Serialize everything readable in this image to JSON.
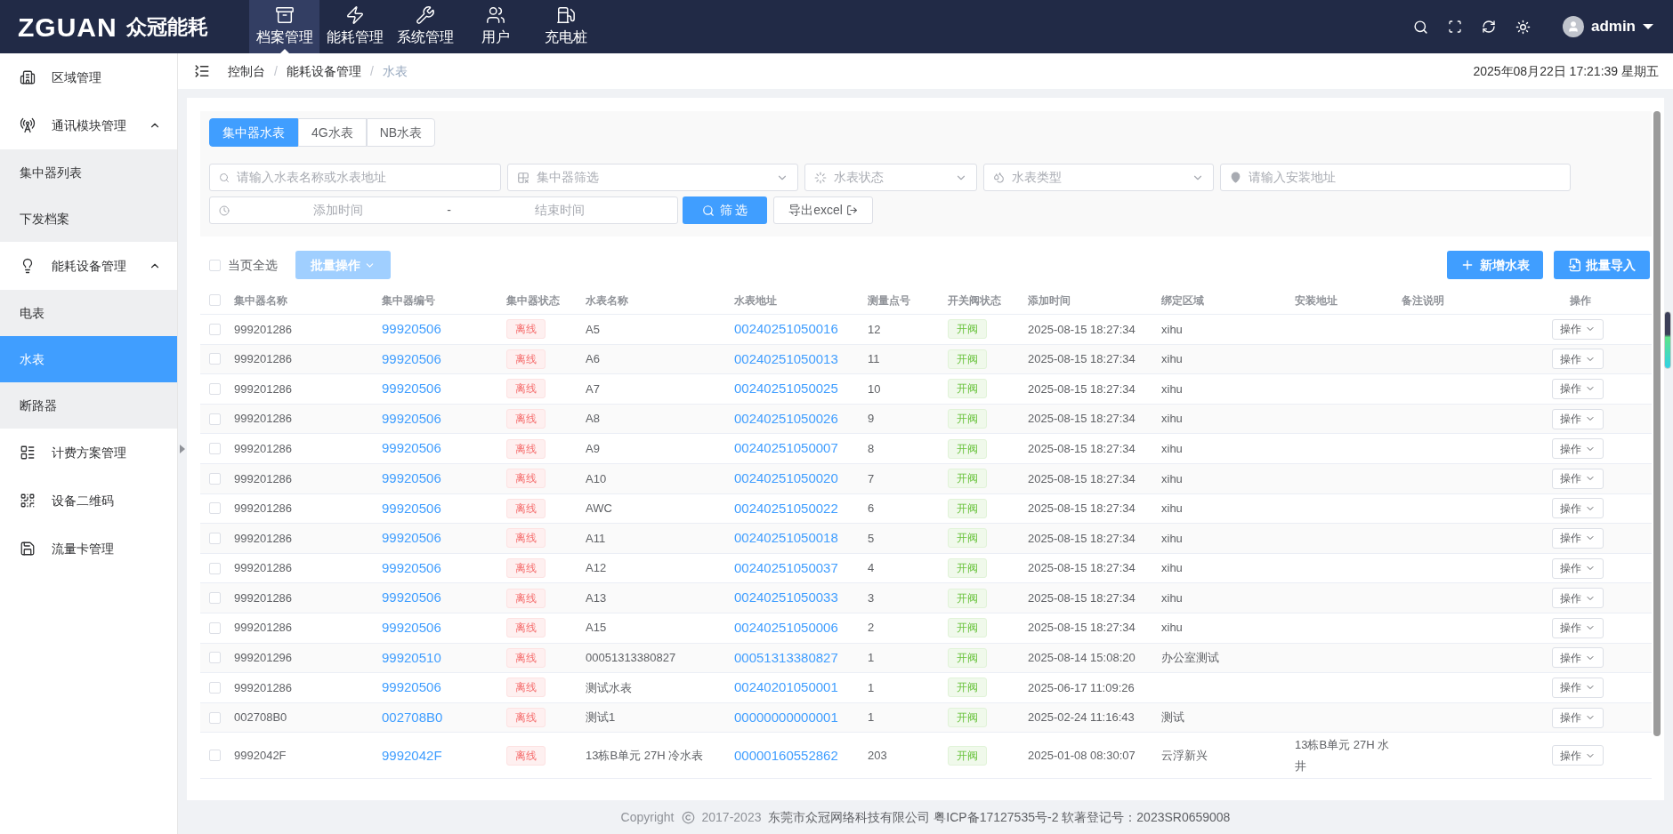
{
  "header": {
    "logo_mark": "ZGUAN",
    "logo_name": "众冠能耗",
    "nav": [
      {
        "label": "档案管理",
        "selected": true
      },
      {
        "label": "能耗管理",
        "selected": false
      },
      {
        "label": "系统管理",
        "selected": false
      },
      {
        "label": "用户",
        "selected": false
      },
      {
        "label": "充电桩",
        "selected": false
      }
    ],
    "user": "admin"
  },
  "sidebar": {
    "items": [
      {
        "label": "区域管理"
      },
      {
        "label": "通讯模块管理",
        "expanded": true,
        "children": [
          {
            "label": "集中器列表",
            "selected": false
          },
          {
            "label": "下发档案",
            "selected": false
          }
        ]
      },
      {
        "label": "能耗设备管理",
        "expanded": true,
        "children": [
          {
            "label": "电表",
            "selected": false
          },
          {
            "label": "水表",
            "selected": true
          },
          {
            "label": "断路器",
            "selected": false
          }
        ]
      },
      {
        "label": "计费方案管理"
      },
      {
        "label": "设备二维码"
      },
      {
        "label": "流量卡管理"
      }
    ]
  },
  "breadcrumb": {
    "items": [
      "控制台",
      "能耗设备管理",
      "水表"
    ],
    "separators": [
      "/",
      "/"
    ]
  },
  "datetime": "2025年08月22日 17:21:39 星期五",
  "tabs": [
    {
      "label": "集中器水表",
      "selected": true
    },
    {
      "label": "4G水表",
      "selected": false
    },
    {
      "label": "NB水表",
      "selected": false
    }
  ],
  "filters": {
    "search": {
      "placeholder": "请输入水表名称或水表地址"
    },
    "concentrator": {
      "placeholder": "集中器筛选"
    },
    "status": {
      "placeholder": "水表状态"
    },
    "type": {
      "placeholder": "水表类型"
    },
    "address": {
      "placeholder": "请输入安装地址"
    },
    "start_time": {
      "placeholder": "添加时间"
    },
    "separator": "-",
    "end_time": {
      "placeholder": "结束时间"
    },
    "filter_button": "筛 选",
    "export_button": "导出excel"
  },
  "select_all": {
    "label": "当页全选",
    "checked": false
  },
  "batch_button": "批量操作",
  "add_button": "新增水表",
  "import_button": "批量导入",
  "table": {
    "header_checked": false,
    "columns": [
      "集中器名称",
      "集中器编号",
      "集中器状态",
      "水表名称",
      "水表地址",
      "测量点号",
      "开关阀状态",
      "添加时间",
      "绑定区域",
      "安装地址",
      "备注说明",
      "操作"
    ],
    "rows": [
      {
        "checked": false,
        "name": "999201286",
        "number": "99920506",
        "status": "离线",
        "meter": "A5",
        "address": "00240251050016",
        "point": "12",
        "valve": "开阀",
        "time": "2025-08-15 18:27:34",
        "area": "xihu",
        "op": "操作"
      },
      {
        "checked": false,
        "name": "999201286",
        "number": "99920506",
        "status": "离线",
        "meter": "A6",
        "address": "00240251050013",
        "point": "11",
        "valve": "开阀",
        "time": "2025-08-15 18:27:34",
        "area": "xihu",
        "op": "操作"
      },
      {
        "checked": false,
        "name": "999201286",
        "number": "99920506",
        "status": "离线",
        "meter": "A7",
        "address": "00240251050025",
        "point": "10",
        "valve": "开阀",
        "time": "2025-08-15 18:27:34",
        "area": "xihu",
        "op": "操作"
      },
      {
        "checked": false,
        "name": "999201286",
        "number": "99920506",
        "status": "离线",
        "meter": "A8",
        "address": "00240251050026",
        "point": "9",
        "valve": "开阀",
        "time": "2025-08-15 18:27:34",
        "area": "xihu",
        "op": "操作"
      },
      {
        "checked": false,
        "name": "999201286",
        "number": "99920506",
        "status": "离线",
        "meter": "A9",
        "address": "00240251050007",
        "point": "8",
        "valve": "开阀",
        "time": "2025-08-15 18:27:34",
        "area": "xihu",
        "op": "操作"
      },
      {
        "checked": false,
        "name": "999201286",
        "number": "99920506",
        "status": "离线",
        "meter": "A10",
        "address": "00240251050020",
        "point": "7",
        "valve": "开阀",
        "time": "2025-08-15 18:27:34",
        "area": "xihu",
        "op": "操作"
      },
      {
        "checked": false,
        "name": "999201286",
        "number": "99920506",
        "status": "离线",
        "meter": "AWC",
        "address": "00240251050022",
        "point": "6",
        "valve": "开阀",
        "time": "2025-08-15 18:27:34",
        "area": "xihu",
        "op": "操作"
      },
      {
        "checked": false,
        "name": "999201286",
        "number": "99920506",
        "status": "离线",
        "meter": "A11",
        "address": "00240251050018",
        "point": "5",
        "valve": "开阀",
        "time": "2025-08-15 18:27:34",
        "area": "xihu",
        "op": "操作"
      },
      {
        "checked": false,
        "name": "999201286",
        "number": "99920506",
        "status": "离线",
        "meter": "A12",
        "address": "00240251050037",
        "point": "4",
        "valve": "开阀",
        "time": "2025-08-15 18:27:34",
        "area": "xihu",
        "op": "操作"
      },
      {
        "checked": false,
        "name": "999201286",
        "number": "99920506",
        "status": "离线",
        "meter": "A13",
        "address": "00240251050033",
        "point": "3",
        "valve": "开阀",
        "time": "2025-08-15 18:27:34",
        "area": "xihu",
        "op": "操作"
      },
      {
        "checked": false,
        "name": "999201286",
        "number": "99920506",
        "status": "离线",
        "meter": "A15",
        "address": "00240251050006",
        "point": "2",
        "valve": "开阀",
        "time": "2025-08-15 18:27:34",
        "area": "xihu",
        "op": "操作"
      },
      {
        "checked": false,
        "name": "999201296",
        "number": "99920510",
        "status": "离线",
        "meter": "00051313380827",
        "address": "00051313380827",
        "point": "1",
        "valve": "开阀",
        "time": "2025-08-14 15:08:20",
        "area": "办公室测试",
        "op": "操作"
      },
      {
        "checked": false,
        "name": "999201286",
        "number": "99920506",
        "status": "离线",
        "meter": "测试水表",
        "address": "00240201050001",
        "point": "1",
        "valve": "开阀",
        "time": "2025-06-17 11:09:26",
        "op": "操作"
      },
      {
        "checked": false,
        "name": "002708B0",
        "number": "002708B0",
        "status": "离线",
        "meter": "测试1",
        "address": "00000000000001",
        "point": "1",
        "valve": "开阀",
        "time": "2025-02-24 11:16:43",
        "area": "测试",
        "op": "操作"
      },
      {
        "checked": false,
        "name": "9992042F",
        "number": "9992042F",
        "status": "离线",
        "meter": "13栋B单元 27H 冷水表",
        "address": "00000160552862",
        "point": "203",
        "valve": "开阀",
        "time": "2025-01-08 08:30:07",
        "area": "云浮新兴",
        "install": "13栋B单元 27H 水井",
        "op": "操作"
      }
    ]
  },
  "footer": {
    "copyright": "Copyright",
    "years": "2017-2023",
    "company": "东莞市众冠网络科技有限公司 粤ICP备17127535号-2 软著登记号：2023SR0659008"
  }
}
